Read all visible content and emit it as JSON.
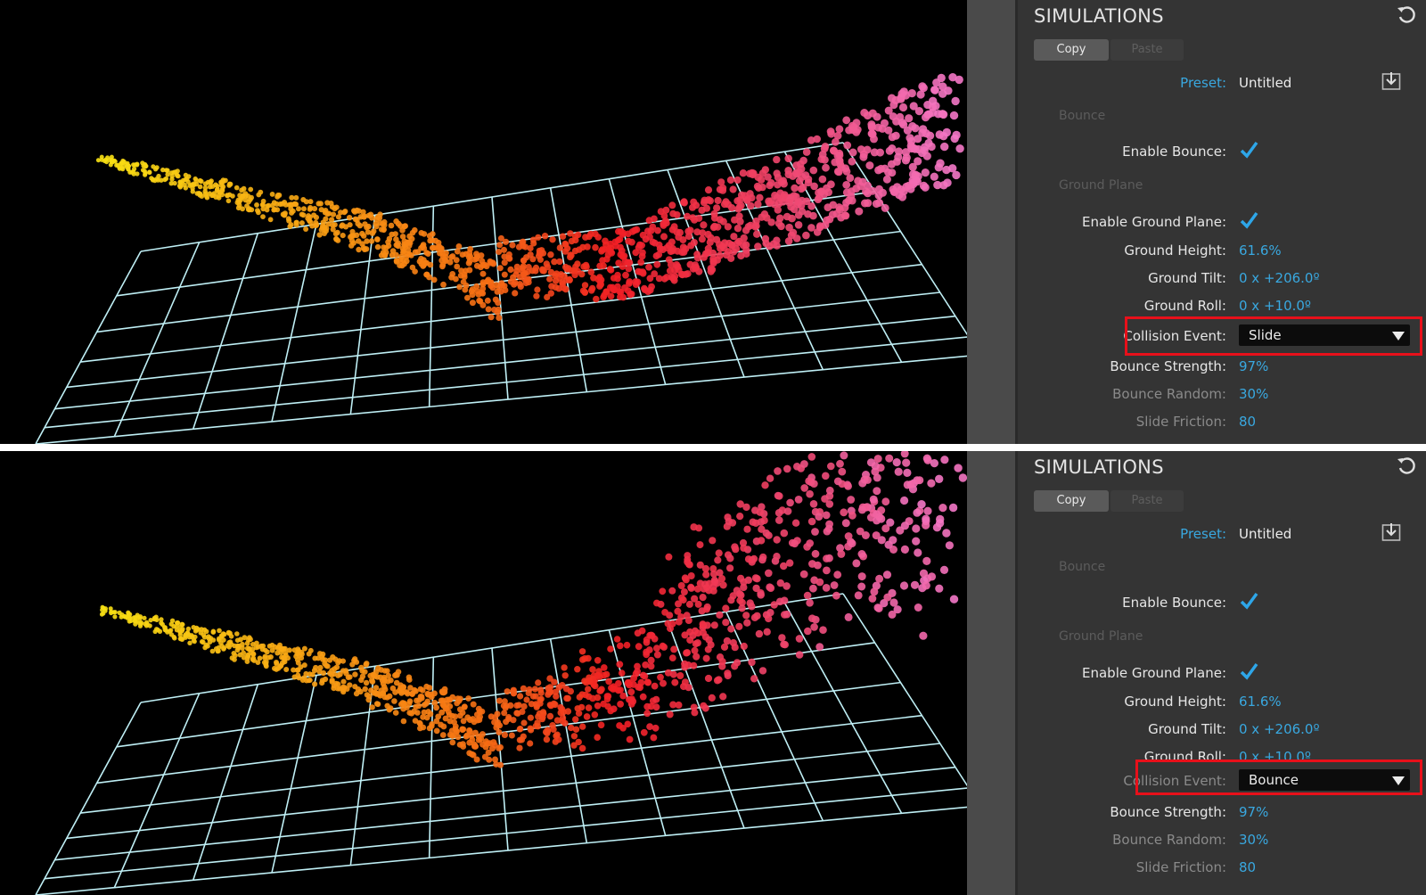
{
  "panels": [
    {
      "sidebar": {
        "title": "SIMULATIONS",
        "copy_label": "Copy",
        "paste_label": "Paste",
        "preset_label": "Preset:",
        "preset_value": "Untitled",
        "bounce_section": "Bounce",
        "enable_bounce_label": "Enable Bounce:",
        "ground_plane_section": "Ground Plane",
        "enable_ground_label": "Enable Ground Plane:",
        "ground_height_label": "Ground Height:",
        "ground_height_value": "61.6%",
        "ground_tilt_label": "Ground Tilt:",
        "ground_tilt_value": "0 x +206.0º",
        "ground_roll_label": "Ground Roll:",
        "ground_roll_value": "0 x +10.0º",
        "collision_label": "Collision Event:",
        "collision_value": "Slide",
        "bounce_strength_label": "Bounce Strength:",
        "bounce_strength_value": "97%",
        "bounce_random_label": "Bounce Random:",
        "bounce_random_value": "30%",
        "slide_friction_label": "Slide Friction:",
        "slide_friction_value": "80"
      }
    },
    {
      "sidebar": {
        "title": "SIMULATIONS",
        "copy_label": "Copy",
        "paste_label": "Paste",
        "preset_label": "Preset:",
        "preset_value": "Untitled",
        "bounce_section": "Bounce",
        "enable_bounce_label": "Enable Bounce:",
        "ground_plane_section": "Ground Plane",
        "enable_ground_label": "Enable Ground Plane:",
        "ground_height_label": "Ground Height:",
        "ground_height_value": "61.6%",
        "ground_tilt_label": "Ground Tilt:",
        "ground_tilt_value": "0 x +206.0º",
        "ground_roll_label": "Ground Roll:",
        "ground_roll_value": "0 x +10.0º",
        "collision_label": "Collision Event:",
        "collision_value": "Bounce",
        "bounce_strength_label": "Bounce Strength:",
        "bounce_strength_value": "97%",
        "bounce_random_label": "Bounce Random:",
        "bounce_random_value": "30%",
        "slide_friction_label": "Slide Friction:",
        "slide_friction_value": "80"
      }
    }
  ],
  "icons": [
    "reset-icon",
    "save-preset-icon",
    "checkmark-icon",
    "dropdown-arrow-icon"
  ],
  "colors": {
    "accent": "#39a8e0",
    "highlight": "#e8101a",
    "grid": "#bfeff5",
    "particle_yellow": "#f5e21a",
    "particle_orange": "#f58a1a",
    "particle_red": "#f2202a",
    "particle_pink": "#f472b8"
  }
}
